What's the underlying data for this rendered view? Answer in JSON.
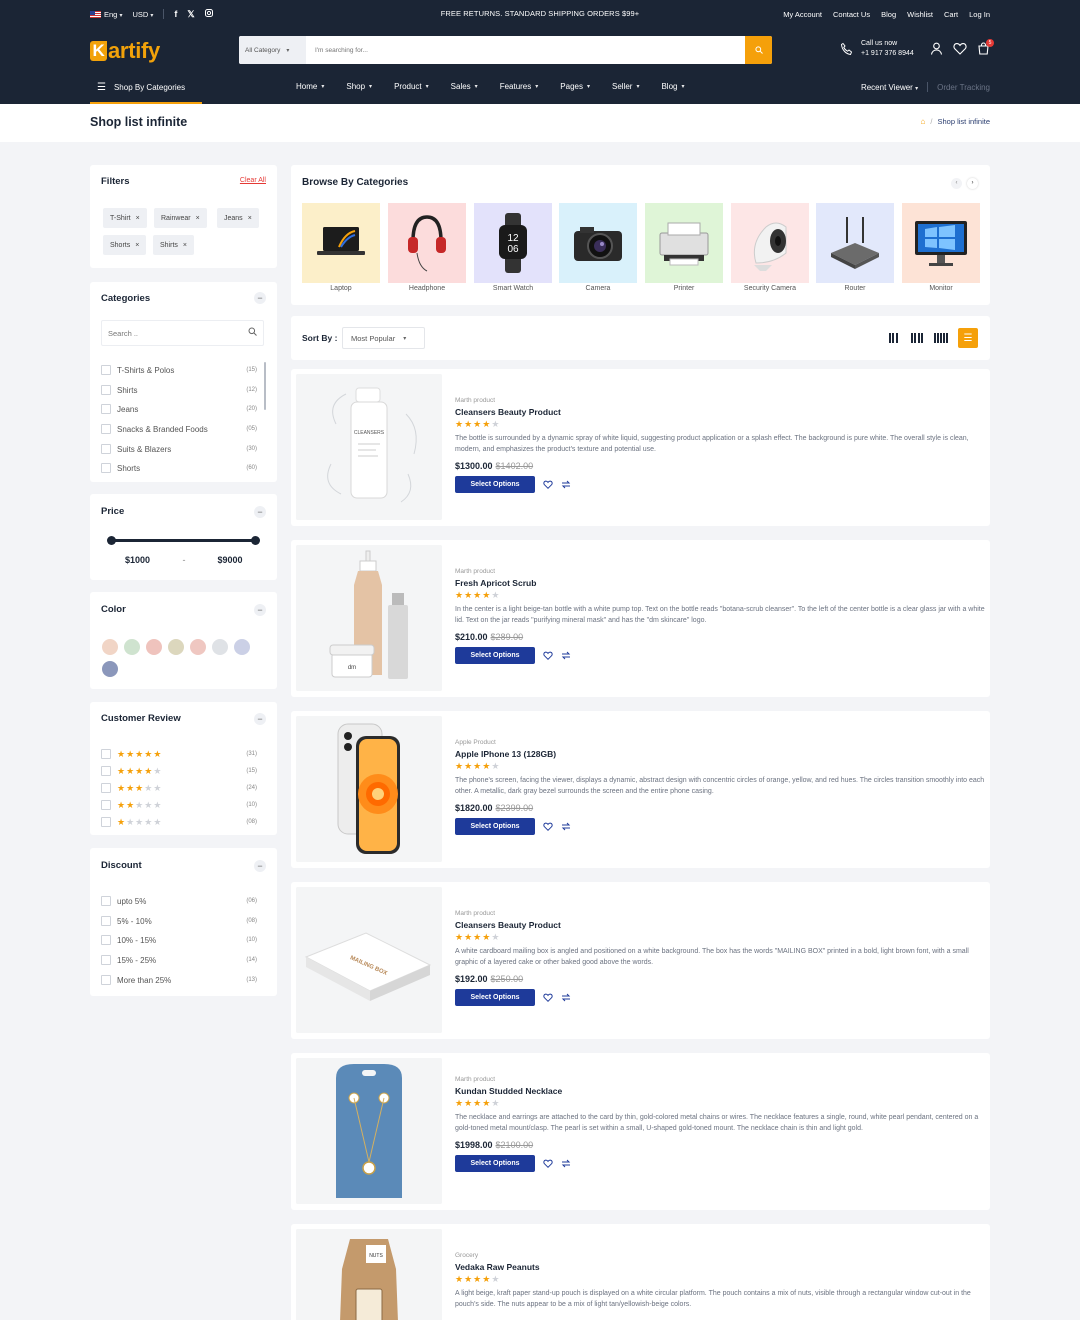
{
  "topbar": {
    "lang": "Eng",
    "currency": "USD",
    "announcement": "FREE RETURNS. STANDARD SHIPPING ORDERS $99+",
    "links": [
      "My Account",
      "Contact Us",
      "Blog",
      "Wishlist",
      "Cart",
      "Log In"
    ]
  },
  "header": {
    "logo_letter": "K",
    "logo_rest": "artify",
    "search_category": "All Category",
    "search_placeholder": "I'm searching for...",
    "call_label": "Call us now",
    "call_number": "+1 917 376 8944",
    "cart_count": "5"
  },
  "nav": {
    "shop_by": "Shop By Categories",
    "items": [
      "Home",
      "Shop",
      "Product",
      "Sales",
      "Features",
      "Pages",
      "Seller",
      "Blog"
    ],
    "recent": "Recent Viewer",
    "tracking": "Order Tracking"
  },
  "page": {
    "title": "Shop list infinite",
    "breadcrumb": "Shop list infinite"
  },
  "filters": {
    "title": "Filters",
    "clear": "Clear All",
    "chips": [
      "T-Shirt",
      "Rainwear",
      "Jeans",
      "Shorts",
      "Shirts"
    ]
  },
  "categories": {
    "title": "Categories",
    "search_placeholder": "Search ..",
    "items": [
      {
        "label": "T-Shirts & Polos",
        "count": "(15)"
      },
      {
        "label": "Shirts",
        "count": "(12)"
      },
      {
        "label": "Jeans",
        "count": "(20)"
      },
      {
        "label": "Snacks & Branded Foods",
        "count": "(05)"
      },
      {
        "label": "Suits & Blazers",
        "count": "(30)"
      },
      {
        "label": "Shorts",
        "count": "(60)"
      }
    ]
  },
  "price": {
    "title": "Price",
    "min": "$1000",
    "dash": "-",
    "max": "$9000"
  },
  "color": {
    "title": "Color",
    "swatches": [
      "#f1d5c6",
      "#cfe3cf",
      "#efc3bd",
      "#dcd7bd",
      "#efc7c1",
      "#dfe2e6",
      "#cbd0e6",
      "#8b97bb"
    ]
  },
  "review": {
    "title": "Customer Review",
    "rows": [
      {
        "stars": 5,
        "count": "(31)"
      },
      {
        "stars": 4,
        "count": "(15)"
      },
      {
        "stars": 3,
        "count": "(24)"
      },
      {
        "stars": 2,
        "count": "(10)"
      },
      {
        "stars": 1,
        "count": "(08)"
      }
    ]
  },
  "discount": {
    "title": "Discount",
    "items": [
      {
        "label": "upto 5%",
        "count": "(06)"
      },
      {
        "label": "5% - 10%",
        "count": "(08)"
      },
      {
        "label": "10% - 15%",
        "count": "(10)"
      },
      {
        "label": "15% - 25%",
        "count": "(14)"
      },
      {
        "label": "More than 25%",
        "count": "(13)"
      }
    ]
  },
  "browse": {
    "title": "Browse By Categories",
    "items": [
      {
        "label": "Laptop",
        "bg": "#fcefc9"
      },
      {
        "label": "Headphone",
        "bg": "#fcdcdc"
      },
      {
        "label": "Smart Watch",
        "bg": "#e3e2fb"
      },
      {
        "label": "Camera",
        "bg": "#d9f1fb"
      },
      {
        "label": "Printer",
        "bg": "#dff5d7"
      },
      {
        "label": "Security Camera",
        "bg": "#fde6e6"
      },
      {
        "label": "Router",
        "bg": "#e2e8fb"
      },
      {
        "label": "Monitor",
        "bg": "#fde3d6"
      }
    ]
  },
  "sort": {
    "label": "Sort By :",
    "value": "Most Popular"
  },
  "products": [
    {
      "cat": "Marth product",
      "name": "Cleansers Beauty Product",
      "stars": 4,
      "desc": "The bottle is surrounded by a dynamic spray of white liquid, suggesting product application or a splash effect. The background is pure white. The overall style is clean, modern, and emphasizes the product's texture and potential use.",
      "price": "$1300.00",
      "old": "$1402.00",
      "btn": "Select Options"
    },
    {
      "cat": "Marth product",
      "name": "Fresh Apricot Scrub",
      "stars": 4,
      "desc": "In the center is a light beige-tan bottle with a white pump top. Text on the bottle reads \"botana-scrub cleanser\". To the left of the center bottle is a clear glass jar with a white lid. Text on the jar reads \"purifying mineral mask\" and has the \"dm skincare\" logo.",
      "price": "$210.00",
      "old": "$289.00",
      "btn": "Select Options"
    },
    {
      "cat": "Apple Product",
      "name": "Apple IPhone 13 (128GB)",
      "stars": 4,
      "desc": "The phone's screen, facing the viewer, displays a dynamic, abstract design with concentric circles of orange, yellow, and red hues. The circles transition smoothly into each other. A metallic, dark gray bezel surrounds the screen and the entire phone casing.",
      "price": "$1820.00",
      "old": "$2399.00",
      "btn": "Select Options"
    },
    {
      "cat": "Marth product",
      "name": "Cleansers Beauty Product",
      "stars": 4,
      "desc": "A white cardboard mailing box is angled and positioned on a white background. The box has the words \"MAILING BOX\" printed in a bold, light brown font, with a small graphic of a layered cake or other baked good above the words.",
      "price": "$192.00",
      "old": "$250.00",
      "btn": "Select Options"
    },
    {
      "cat": "Marth product",
      "name": "Kundan Studded Necklace",
      "stars": 4,
      "desc": "The necklace and earrings are attached to the card by thin, gold-colored metal chains or wires. The necklace features a single, round, white pearl pendant, centered on a gold-toned metal mount/clasp. The pearl is set within a small, U-shaped gold-toned mount. The necklace chain is thin and light gold.",
      "price": "$1998.00",
      "old": "$2100.00",
      "btn": "Select Options"
    },
    {
      "cat": "Grocery",
      "name": "Vedaka Raw Peanuts",
      "stars": 4,
      "desc": "A light beige, kraft paper stand-up pouch is displayed on a white circular platform. The pouch contains a mix of nuts, visible through a rectangular window cut-out in the pouch's side. The nuts appear to be a mix of light tan/yellowish-beige colors.",
      "price": "",
      "old": "",
      "btn": ""
    }
  ]
}
